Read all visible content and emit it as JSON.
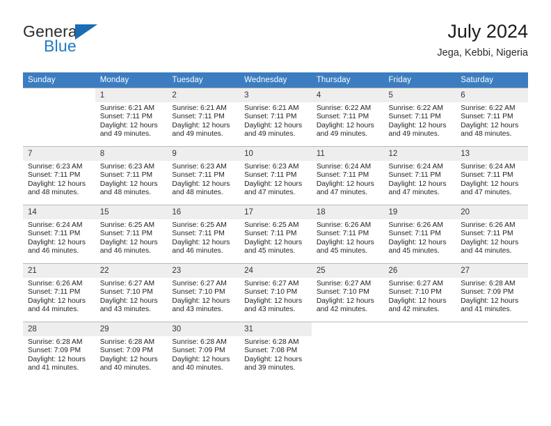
{
  "brand": {
    "name_part1": "General",
    "name_part2": "Blue",
    "accent_color": "#1b6cb3"
  },
  "header": {
    "title": "July 2024",
    "subtitle": "Jega, Kebbi, Nigeria"
  },
  "calendar": {
    "header_bg": "#3b7dc0",
    "daynum_bg": "#eeeeee",
    "weekday_headers": [
      "Sunday",
      "Monday",
      "Tuesday",
      "Wednesday",
      "Thursday",
      "Friday",
      "Saturday"
    ],
    "weeks": [
      [
        {
          "day": "",
          "sunrise": "",
          "sunset": "",
          "daylight": ""
        },
        {
          "day": "1",
          "sunrise": "Sunrise: 6:21 AM",
          "sunset": "Sunset: 7:11 PM",
          "daylight": "Daylight: 12 hours and 49 minutes."
        },
        {
          "day": "2",
          "sunrise": "Sunrise: 6:21 AM",
          "sunset": "Sunset: 7:11 PM",
          "daylight": "Daylight: 12 hours and 49 minutes."
        },
        {
          "day": "3",
          "sunrise": "Sunrise: 6:21 AM",
          "sunset": "Sunset: 7:11 PM",
          "daylight": "Daylight: 12 hours and 49 minutes."
        },
        {
          "day": "4",
          "sunrise": "Sunrise: 6:22 AM",
          "sunset": "Sunset: 7:11 PM",
          "daylight": "Daylight: 12 hours and 49 minutes."
        },
        {
          "day": "5",
          "sunrise": "Sunrise: 6:22 AM",
          "sunset": "Sunset: 7:11 PM",
          "daylight": "Daylight: 12 hours and 49 minutes."
        },
        {
          "day": "6",
          "sunrise": "Sunrise: 6:22 AM",
          "sunset": "Sunset: 7:11 PM",
          "daylight": "Daylight: 12 hours and 48 minutes."
        }
      ],
      [
        {
          "day": "7",
          "sunrise": "Sunrise: 6:23 AM",
          "sunset": "Sunset: 7:11 PM",
          "daylight": "Daylight: 12 hours and 48 minutes."
        },
        {
          "day": "8",
          "sunrise": "Sunrise: 6:23 AM",
          "sunset": "Sunset: 7:11 PM",
          "daylight": "Daylight: 12 hours and 48 minutes."
        },
        {
          "day": "9",
          "sunrise": "Sunrise: 6:23 AM",
          "sunset": "Sunset: 7:11 PM",
          "daylight": "Daylight: 12 hours and 48 minutes."
        },
        {
          "day": "10",
          "sunrise": "Sunrise: 6:23 AM",
          "sunset": "Sunset: 7:11 PM",
          "daylight": "Daylight: 12 hours and 47 minutes."
        },
        {
          "day": "11",
          "sunrise": "Sunrise: 6:24 AM",
          "sunset": "Sunset: 7:11 PM",
          "daylight": "Daylight: 12 hours and 47 minutes."
        },
        {
          "day": "12",
          "sunrise": "Sunrise: 6:24 AM",
          "sunset": "Sunset: 7:11 PM",
          "daylight": "Daylight: 12 hours and 47 minutes."
        },
        {
          "day": "13",
          "sunrise": "Sunrise: 6:24 AM",
          "sunset": "Sunset: 7:11 PM",
          "daylight": "Daylight: 12 hours and 47 minutes."
        }
      ],
      [
        {
          "day": "14",
          "sunrise": "Sunrise: 6:24 AM",
          "sunset": "Sunset: 7:11 PM",
          "daylight": "Daylight: 12 hours and 46 minutes."
        },
        {
          "day": "15",
          "sunrise": "Sunrise: 6:25 AM",
          "sunset": "Sunset: 7:11 PM",
          "daylight": "Daylight: 12 hours and 46 minutes."
        },
        {
          "day": "16",
          "sunrise": "Sunrise: 6:25 AM",
          "sunset": "Sunset: 7:11 PM",
          "daylight": "Daylight: 12 hours and 46 minutes."
        },
        {
          "day": "17",
          "sunrise": "Sunrise: 6:25 AM",
          "sunset": "Sunset: 7:11 PM",
          "daylight": "Daylight: 12 hours and 45 minutes."
        },
        {
          "day": "18",
          "sunrise": "Sunrise: 6:26 AM",
          "sunset": "Sunset: 7:11 PM",
          "daylight": "Daylight: 12 hours and 45 minutes."
        },
        {
          "day": "19",
          "sunrise": "Sunrise: 6:26 AM",
          "sunset": "Sunset: 7:11 PM",
          "daylight": "Daylight: 12 hours and 45 minutes."
        },
        {
          "day": "20",
          "sunrise": "Sunrise: 6:26 AM",
          "sunset": "Sunset: 7:11 PM",
          "daylight": "Daylight: 12 hours and 44 minutes."
        }
      ],
      [
        {
          "day": "21",
          "sunrise": "Sunrise: 6:26 AM",
          "sunset": "Sunset: 7:11 PM",
          "daylight": "Daylight: 12 hours and 44 minutes."
        },
        {
          "day": "22",
          "sunrise": "Sunrise: 6:27 AM",
          "sunset": "Sunset: 7:10 PM",
          "daylight": "Daylight: 12 hours and 43 minutes."
        },
        {
          "day": "23",
          "sunrise": "Sunrise: 6:27 AM",
          "sunset": "Sunset: 7:10 PM",
          "daylight": "Daylight: 12 hours and 43 minutes."
        },
        {
          "day": "24",
          "sunrise": "Sunrise: 6:27 AM",
          "sunset": "Sunset: 7:10 PM",
          "daylight": "Daylight: 12 hours and 43 minutes."
        },
        {
          "day": "25",
          "sunrise": "Sunrise: 6:27 AM",
          "sunset": "Sunset: 7:10 PM",
          "daylight": "Daylight: 12 hours and 42 minutes."
        },
        {
          "day": "26",
          "sunrise": "Sunrise: 6:27 AM",
          "sunset": "Sunset: 7:10 PM",
          "daylight": "Daylight: 12 hours and 42 minutes."
        },
        {
          "day": "27",
          "sunrise": "Sunrise: 6:28 AM",
          "sunset": "Sunset: 7:09 PM",
          "daylight": "Daylight: 12 hours and 41 minutes."
        }
      ],
      [
        {
          "day": "28",
          "sunrise": "Sunrise: 6:28 AM",
          "sunset": "Sunset: 7:09 PM",
          "daylight": "Daylight: 12 hours and 41 minutes."
        },
        {
          "day": "29",
          "sunrise": "Sunrise: 6:28 AM",
          "sunset": "Sunset: 7:09 PM",
          "daylight": "Daylight: 12 hours and 40 minutes."
        },
        {
          "day": "30",
          "sunrise": "Sunrise: 6:28 AM",
          "sunset": "Sunset: 7:09 PM",
          "daylight": "Daylight: 12 hours and 40 minutes."
        },
        {
          "day": "31",
          "sunrise": "Sunrise: 6:28 AM",
          "sunset": "Sunset: 7:08 PM",
          "daylight": "Daylight: 12 hours and 39 minutes."
        },
        {
          "day": "",
          "sunrise": "",
          "sunset": "",
          "daylight": ""
        },
        {
          "day": "",
          "sunrise": "",
          "sunset": "",
          "daylight": ""
        },
        {
          "day": "",
          "sunrise": "",
          "sunset": "",
          "daylight": ""
        }
      ]
    ]
  }
}
